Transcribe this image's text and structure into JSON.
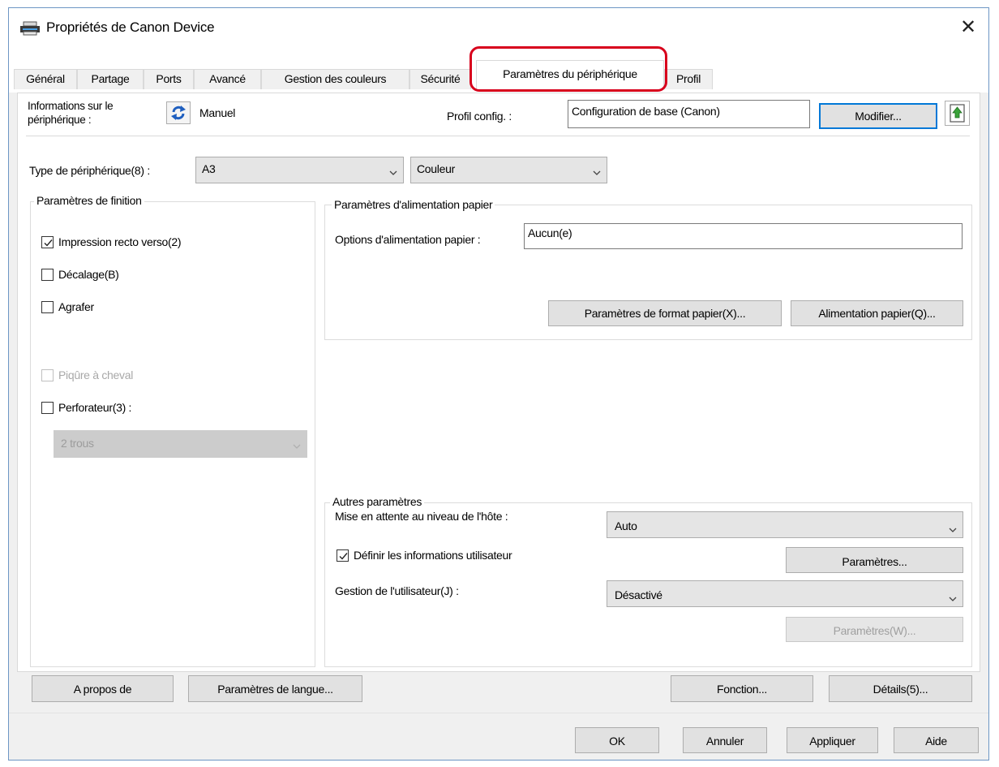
{
  "window": {
    "title": "Propriétés de Canon Device",
    "close": "✕"
  },
  "tabs": [
    {
      "label": "Général"
    },
    {
      "label": "Partage"
    },
    {
      "label": "Ports"
    },
    {
      "label": "Avancé"
    },
    {
      "label": "Gestion des couleurs"
    },
    {
      "label": "Sécurité"
    },
    {
      "label": "Paramètres du périphérique",
      "active": true
    },
    {
      "label": "Profil"
    }
  ],
  "device_info": {
    "label": "Informations sur le périphérique :",
    "label_line1": "Informations sur le",
    "label_line2": "périphérique :",
    "mode": "Manuel",
    "profile_label": "Profil config. :",
    "profile_value": "Configuration de base (Canon)",
    "modify_button": "Modifier..."
  },
  "device_type": {
    "label": "Type de périphérique(8) :",
    "size": "A3",
    "color": "Couleur"
  },
  "finishing": {
    "title": "Paramètres de finition",
    "duplex": {
      "label": "Impression recto verso(2)",
      "checked": true
    },
    "offset": {
      "label": "Décalage(B)",
      "checked": false
    },
    "staple": {
      "label": "Agrafer",
      "checked": false
    },
    "saddle": {
      "label": "Piqûre à cheval",
      "checked": false,
      "disabled": true
    },
    "punch": {
      "label": "Perforateur(3) :",
      "checked": false
    },
    "punch_option": "2 trous"
  },
  "paper_source": {
    "title": "Paramètres d'alimentation papier",
    "options_label": "Options d'alimentation papier :",
    "options_value": "Aucun(e)",
    "format_button": "Paramètres de format papier(X)...",
    "feed_button": "Alimentation papier(Q)..."
  },
  "other": {
    "title": "Autres paramètres",
    "spool_label": "Mise en attente au niveau de l'hôte :",
    "spool_value": "Auto",
    "user_info_label": "Définir les informations utilisateur",
    "user_info_checked": true,
    "settings_button": "Paramètres...",
    "user_mgmt_label": "Gestion de l'utilisateur(J) :",
    "user_mgmt_value": "Désactivé",
    "settings_w_button": "Paramètres(W)..."
  },
  "bottom_buttons": {
    "about": "A propos de",
    "language": "Paramètres de langue...",
    "function": "Fonction...",
    "details": "Détails(5)..."
  },
  "dialog_buttons": {
    "ok": "OK",
    "cancel": "Annuler",
    "apply": "Appliquer",
    "help": "Aide"
  },
  "colors": {
    "highlight": "#d8001c",
    "accent": "#0078d7"
  },
  "icons": {
    "window": "printer-icon",
    "mode": "refresh-icon",
    "export": "upload-icon"
  }
}
